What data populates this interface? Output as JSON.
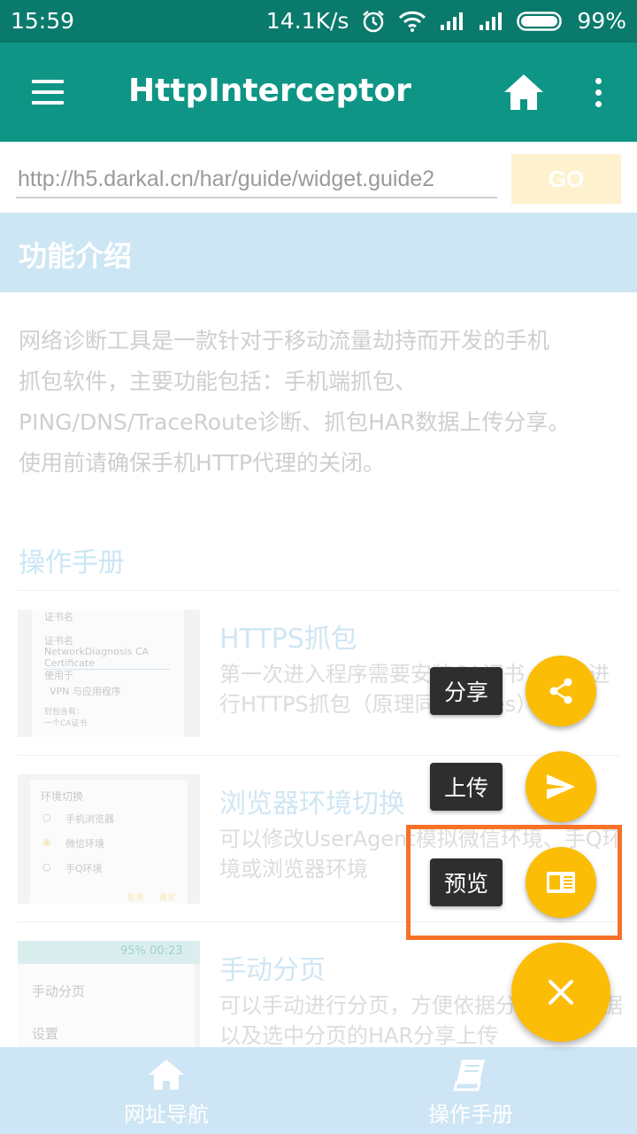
{
  "status_bar": {
    "time": "15:59",
    "net_speed": "14.1K/s",
    "battery": "99%",
    "icons": [
      "alarm-icon",
      "wifi-icon",
      "signal-icon",
      "signal-icon",
      "battery-icon"
    ]
  },
  "app_bar": {
    "title": "HttpInterceptor",
    "icons": [
      "menu-icon",
      "home-icon",
      "more-vert-icon"
    ]
  },
  "url_bar": {
    "value": "http://h5.darkal.cn/har/guide/widget.guide2",
    "go_label": "GO"
  },
  "feature": {
    "title": "功能介绍",
    "lines": [
      "网络诊断工具是一款针对于移动流量劫持而开发的手机",
      "抓包软件，主要功能包括：手机端抓包、",
      "PING/DNS/TraceRoute诊断、抓包HAR数据上传分享。",
      "使用前请确保手机HTTP代理的关闭。"
    ]
  },
  "manual": {
    "title": "操作手册",
    "items": [
      {
        "title": "HTTPS抓包",
        "desc": "第一次进入程序需要安装CA证书，才能进行HTTPS抓包（原理同Charles）...",
        "thumb": {
          "heading": "证书名",
          "label1": "证书名",
          "value1": "NetworkDiagnosis CA Certificate",
          "label2": "使用于",
          "value2": "VPN 与应用程序",
          "label3": "封包含有：",
          "value3": "一个CA证书"
        }
      },
      {
        "title": "浏览器环境切换",
        "desc": "可以修改UserAgent模拟微信环境、手Q环境或浏览器环境",
        "thumb": {
          "heading": "环境切换",
          "options": [
            "手机浏览器",
            "微信环境",
            "手Q环境"
          ],
          "ok": "确定",
          "cancel": "取消"
        }
      },
      {
        "title": "手动分页",
        "desc": "可以手动进行分页，方便依据分页预览数据以及选中分页的HAR分享上传",
        "thumb": {
          "status": "95% 00:23",
          "row1": "手动分页",
          "row2": "设置"
        }
      }
    ]
  },
  "fab_menu": {
    "share_label": "分享",
    "upload_label": "上传",
    "preview_label": "预览",
    "highlight_color": "#f57226",
    "fab_color": "#fbbd06"
  },
  "bottom_nav": {
    "items": [
      {
        "label": "网址导航",
        "icon": "home-icon"
      },
      {
        "label": "操作手册",
        "icon": "book-icon"
      }
    ]
  },
  "colors": {
    "status_bar": "#0a7a6c",
    "app_bar": "#0e9585",
    "accent": "#fbbd06"
  }
}
